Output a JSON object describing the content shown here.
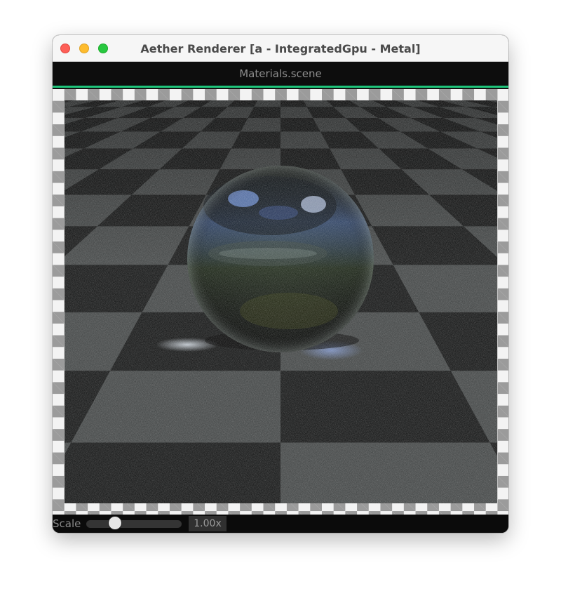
{
  "window": {
    "title": "Aether Renderer [a - IntegratedGpu - Metal]"
  },
  "tab": {
    "label": "Materials.scene",
    "indicator_color": "#1fc47a"
  },
  "controls": {
    "scale_label": "Scale",
    "scale_value_text": "1.00x",
    "slider_fraction": 0.27
  },
  "viewport": {
    "content": "path-traced render: reflective glass sphere on a dark checkered floor",
    "background": "transparency checkerboard"
  },
  "icons": [
    "close-button",
    "minimize-button",
    "zoom-button"
  ],
  "colors": {
    "close": "#fe5f57",
    "minimize": "#febc2e",
    "zoom": "#28c840"
  }
}
